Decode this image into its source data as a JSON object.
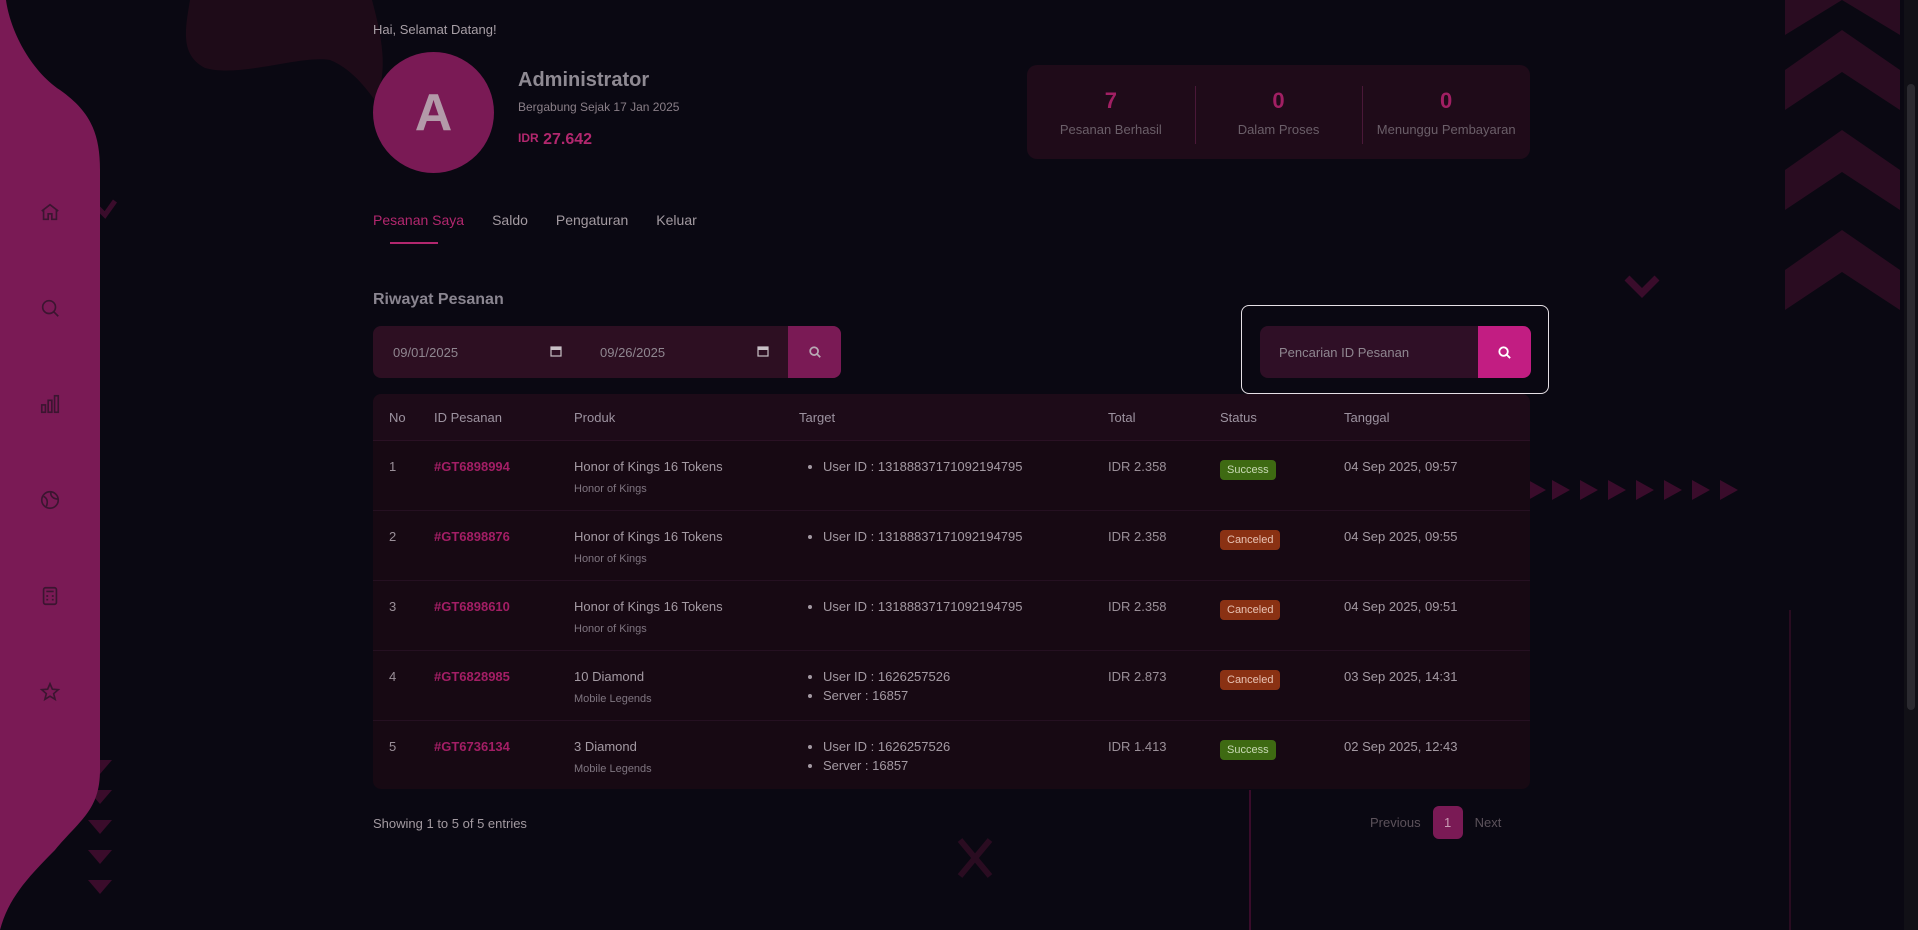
{
  "greeting": "Hai, Selamat Datang!",
  "profile": {
    "avatar_letter": "A",
    "name": "Administrator",
    "joined": "Bergabung Sejak 17 Jan 2025",
    "balance_currency": "IDR",
    "balance_amount": "27.642"
  },
  "stats": [
    {
      "value": "7",
      "label": "Pesanan Berhasil"
    },
    {
      "value": "0",
      "label": "Dalam Proses"
    },
    {
      "value": "0",
      "label": "Menunggu Pembayaran"
    }
  ],
  "tabs": [
    {
      "label": "Pesanan Saya",
      "active": true
    },
    {
      "label": "Saldo"
    },
    {
      "label": "Pengaturan"
    },
    {
      "label": "Keluar"
    }
  ],
  "sidebar": {
    "icons": [
      "home-icon",
      "search-icon",
      "chart-icon",
      "globe-icon",
      "calculator-icon",
      "star-icon"
    ]
  },
  "orders": {
    "title": "Riwayat Pesanan",
    "date_from": "09/01/2025",
    "date_to": "09/26/2025",
    "search_placeholder": "Pencarian ID Pesanan",
    "columns": [
      "No",
      "ID Pesanan",
      "Produk",
      "Target",
      "Total",
      "Status",
      "Tanggal"
    ],
    "rows": [
      {
        "no": "1",
        "id": "#GT6898994",
        "product": "Honor of Kings 16 Tokens",
        "game": "Honor of Kings",
        "targets": [
          "User ID : 13188837171092194795"
        ],
        "total": "IDR 2.358",
        "status": "Success",
        "date": "04 Sep 2025, 09:57"
      },
      {
        "no": "2",
        "id": "#GT6898876",
        "product": "Honor of Kings 16 Tokens",
        "game": "Honor of Kings",
        "targets": [
          "User ID : 13188837171092194795"
        ],
        "total": "IDR 2.358",
        "status": "Canceled",
        "date": "04 Sep 2025, 09:55"
      },
      {
        "no": "3",
        "id": "#GT6898610",
        "product": "Honor of Kings 16 Tokens",
        "game": "Honor of Kings",
        "targets": [
          "User ID : 13188837171092194795"
        ],
        "total": "IDR 2.358",
        "status": "Canceled",
        "date": "04 Sep 2025, 09:51"
      },
      {
        "no": "4",
        "id": "#GT6828985",
        "product": "10 Diamond",
        "game": "Mobile Legends",
        "targets": [
          "User ID : 1626257526",
          "Server : 16857"
        ],
        "total": "IDR 2.873",
        "status": "Canceled",
        "date": "03 Sep 2025, 14:31"
      },
      {
        "no": "5",
        "id": "#GT6736134",
        "product": "3 Diamond",
        "game": "Mobile Legends",
        "targets": [
          "User ID : 1626257526",
          "Server : 16857"
        ],
        "total": "IDR 1.413",
        "status": "Success",
        "date": "02 Sep 2025, 12:43"
      }
    ],
    "entries_text": "Showing 1 to 5 of 5 entries",
    "pager": {
      "prev": "Previous",
      "page": "1",
      "next": "Next"
    }
  },
  "colors": {
    "accent": "#b2276e",
    "sidebar": "#7a1a55",
    "background": "#0a0812"
  }
}
